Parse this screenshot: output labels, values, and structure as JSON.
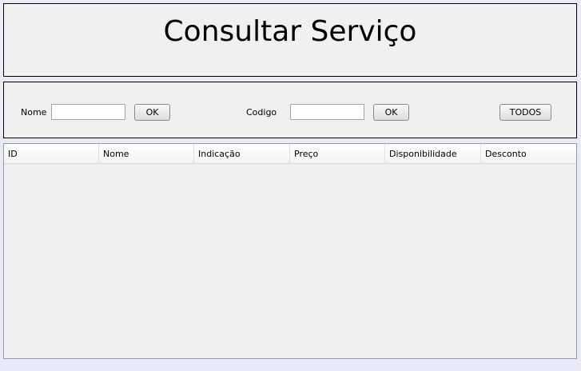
{
  "header": {
    "title": "Consultar Serviço"
  },
  "search": {
    "nome_label": "Nome",
    "nome_value": "",
    "nome_ok_label": "OK",
    "codigo_label": "Codigo",
    "codigo_value": "",
    "codigo_ok_label": "OK",
    "todos_label": "TODOS"
  },
  "table": {
    "columns": [
      "ID",
      "Nome",
      "Indicação",
      "Preço",
      "Disponibilidade",
      "Desconto"
    ],
    "rows": []
  }
}
